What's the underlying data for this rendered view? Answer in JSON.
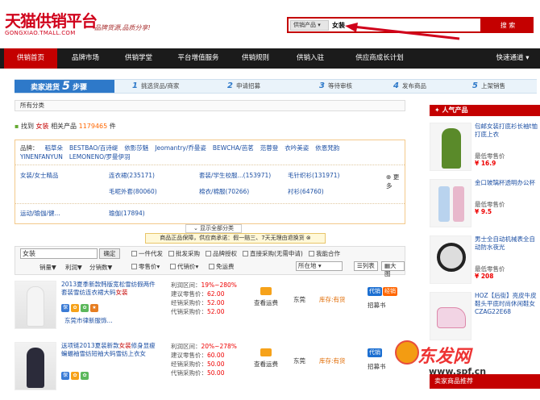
{
  "header": {
    "logo": "天猫供销平台",
    "logo_url": "GONGXIAO.TMALL.COM",
    "slogan": "品牌货源,品质分享!"
  },
  "search": {
    "category": "供销产品 ▾",
    "query": "女装",
    "button": "搜 索"
  },
  "nav": {
    "items": [
      "供销首页",
      "品牌市场",
      "供销学堂",
      "平台增值服务",
      "供销规则",
      "供销入驻",
      "供应商成长计划"
    ],
    "right": "快速通道 ▾"
  },
  "steps": {
    "head_prefix": "卖家进货",
    "head_num": "5",
    "head_suffix": "步骤",
    "items": [
      {
        "num": "1",
        "label": "挑选货品/商家"
      },
      {
        "num": "2",
        "label": "申请招募"
      },
      {
        "num": "3",
        "label": "等待审核"
      },
      {
        "num": "4",
        "label": "发布商品"
      },
      {
        "num": "5",
        "label": "上架销售"
      }
    ]
  },
  "breadcrumb": "所有分类",
  "found": {
    "prefix": "找到",
    "keyword": "女装",
    "middle": "相关产品",
    "count": "1179465",
    "suffix": "件"
  },
  "filter": {
    "brand_label": "品牌：",
    "brands": [
      "稻草朵",
      "BESTBAO/百诗缇",
      "依影莎魅",
      "Jeomantry/乔曼姿",
      "BEWCHA/芭茗",
      "范蓉登",
      "衣吟美姿",
      "依恩梵韵",
      "YINENFANYUN",
      "LEMONENO/罗曼伊羽"
    ],
    "categories": [
      {
        "label": "女装/女士精品",
        "items": [
          {
            "text": "连衣裙(235171)"
          },
          {
            "text": "套装/学生校服...(153971)"
          },
          {
            "text": "毛针织衫(131971)"
          },
          {
            "text": "毛呢外套(80060)"
          },
          {
            "text": "棉衣/棉服(70266)"
          },
          {
            "text": "衬衫(64760)"
          }
        ]
      },
      {
        "label": "运动/瑜伽/健...",
        "items": [
          {
            "text": "瑜伽(17894)"
          }
        ]
      }
    ],
    "more": "更多",
    "show_all": "显示全部分类"
  },
  "guarantee": "商品正品保障，供应商承诺：假一赔三、7天无理由退换货",
  "toolbar": {
    "input_value": "女装",
    "confirm": "确定",
    "checks_row1": [
      "一件代发",
      "批发采购",
      "品牌授权",
      "直接采购(无需申请)",
      "我能合作"
    ],
    "sorts": [
      "销量",
      "利润",
      "分销数"
    ],
    "checks_row2": [
      "零售价",
      "代销价",
      "免运费"
    ],
    "location": "所在地",
    "view_list": "列表",
    "view_grid": "大图"
  },
  "products": [
    {
      "title_pre": "2013夏季新款韩版宽松雪纺假两件套装雪纺连衣裙大码",
      "title_kw": "女装",
      "company": "东莞市律新服饰...",
      "profit_label": "利润区间：",
      "profit": "19%~280%",
      "retail_label": "建议零售价：",
      "retail": "62.00",
      "agent_label": "经销采购价：",
      "agent": "52.00",
      "dist_label": "代销采购价：",
      "dist": "52.00",
      "shipping": "查看运费",
      "origin": "东莞",
      "stock": "库存:有货",
      "tag1": "代销",
      "tag2": "经销",
      "action": "招募书"
    },
    {
      "title_pre": "送项链2013夏装新款",
      "title_kw": "女装",
      "title_post": "修身显瘦蝙蝠袖雪纺短袖大码雪纺上衣女",
      "profit_label": "利润区间：",
      "profit": "20%~278%",
      "retail_label": "建议零售价：",
      "retail": "60.00",
      "agent_label": "经销采购价：",
      "agent": "50.00",
      "dist_label": "代销采购价：",
      "dist": "50.00",
      "shipping": "查看运费",
      "origin": "东莞",
      "stock": "库存:有货",
      "tag1": "代销",
      "action": "招募书"
    }
  ],
  "hot": {
    "title": "人气产品",
    "price_label": "最低零售价",
    "items": [
      {
        "title": "包邮女装打底衫长袖t恤打底上衣",
        "price": "¥ 16.9"
      },
      {
        "title": "金口玻璃杯透明办公杯",
        "price": "¥ 9.5"
      },
      {
        "title": "男士全自动机械表全自动防水夜光",
        "price": "¥ 208"
      },
      {
        "title": "HOZ【后街】亮皮牛皮鞋头平底时尚休闲鞋女CZAG22E68",
        "price": ""
      }
    ],
    "recommend": "卖家商品推荐"
  },
  "watermark": {
    "text": "东发网",
    "url": "www.spf.cn"
  },
  "colors": {
    "brand": "#c40000",
    "nav": "#1b1b1b",
    "link": "#1c4fa3",
    "step": "#2e79c9"
  }
}
